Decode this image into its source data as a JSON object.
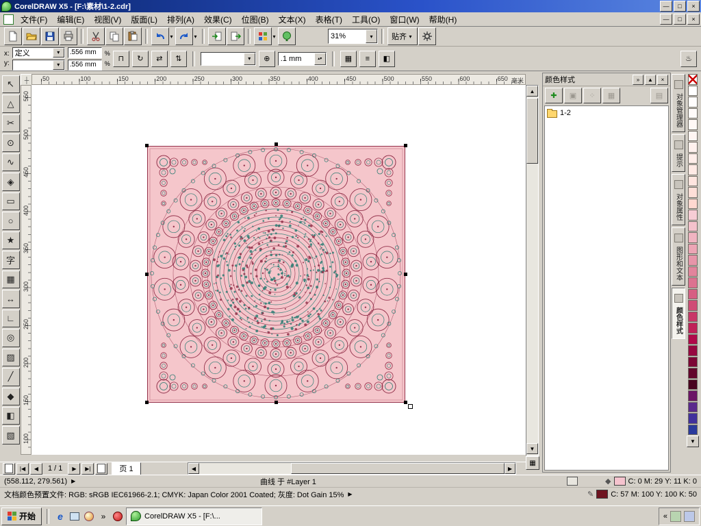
{
  "window": {
    "title": "CorelDRAW X5 - [F:\\素材\\1-2.cdr]"
  },
  "icons": {
    "minimize": "—",
    "maximize": "□",
    "close": "×",
    "dropdown": "▾",
    "scroll_up": "▲",
    "scroll_down": "▼",
    "scroll_left": "◀",
    "scroll_right": "▶",
    "nav_first": "|◀",
    "nav_prev": "◀",
    "nav_next": "▶",
    "nav_last": "▶|",
    "docker_chevron": "»",
    "docker_rollup": "▲",
    "docker_close": "×",
    "ql_chevron": "»",
    "tray_chevron": "«",
    "navigator": "▦",
    "ruler_origin": "┼",
    "ie": "e",
    "coord_flyout": "▶",
    "profile_flyout": "▶",
    "fill_status": "◆",
    "outline_status": "✎"
  },
  "menubar": {
    "items": [
      "文件(F)",
      "编辑(E)",
      "视图(V)",
      "版面(L)",
      "排列(A)",
      "效果(C)",
      "位图(B)",
      "文本(X)",
      "表格(T)",
      "工具(O)",
      "窗口(W)",
      "帮助(H)"
    ]
  },
  "toolbar": {
    "zoom_value": "31%",
    "snap_label": "贴齐",
    "items": [
      {
        "icon": "new",
        "name": "new-button"
      },
      {
        "icon": "open",
        "name": "open-button"
      },
      {
        "icon": "save",
        "name": "save-button"
      },
      {
        "icon": "print",
        "name": "print-button"
      },
      {
        "sep": true
      },
      {
        "icon": "cut",
        "name": "cut-button"
      },
      {
        "icon": "copy",
        "name": "copy-button"
      },
      {
        "icon": "paste",
        "name": "paste-button"
      },
      {
        "sep": true
      },
      {
        "icon": "undo",
        "name": "undo-button",
        "dropdown": true
      },
      {
        "icon": "redo",
        "name": "redo-button",
        "dropdown": true
      },
      {
        "sep": true
      },
      {
        "icon": "import",
        "name": "import-button"
      },
      {
        "icon": "export",
        "name": "export-button"
      },
      {
        "sep": true
      },
      {
        "icon": "app-launcher",
        "name": "application-launcher-button",
        "dropdown": true
      },
      {
        "icon": "welcome",
        "name": "welcome-screen-button"
      },
      {
        "zoom": true
      },
      {
        "sep": true
      },
      {
        "snap": true
      },
      {
        "icon": "options",
        "name": "options-button"
      }
    ]
  },
  "propbar": {
    "x_label": "x:",
    "y_label": "y:",
    "preset_value": "定义",
    "width_value": ".556 mm",
    "height_value": ".556 mm",
    "percent_label": "%",
    "nudge_value": ".1 mm"
  },
  "rulers": {
    "unit_label": "毫米",
    "h_ticks": [
      "50",
      "100",
      "150",
      "200",
      "250",
      "300",
      "350",
      "400",
      "450",
      "500",
      "550",
      "600",
      "650"
    ],
    "v_ticks": [
      "550",
      "500",
      "450",
      "400",
      "350",
      "300",
      "250",
      "200",
      "150",
      "100"
    ]
  },
  "toolbox": {
    "tools": [
      {
        "name": "pick-tool",
        "glyph": "↖"
      },
      {
        "name": "shape-tool",
        "glyph": "△"
      },
      {
        "name": "crop-tool",
        "glyph": "✂"
      },
      {
        "name": "zoom-tool",
        "glyph": "⊙"
      },
      {
        "name": "freehand-tool",
        "glyph": "∿"
      },
      {
        "name": "smart-fill-tool",
        "glyph": "◈"
      },
      {
        "name": "rectangle-tool",
        "glyph": "▭"
      },
      {
        "name": "ellipse-tool",
        "glyph": "○"
      },
      {
        "name": "polygon-tool",
        "glyph": "★"
      },
      {
        "name": "text-tool",
        "glyph": "字"
      },
      {
        "name": "table-tool",
        "glyph": "▦"
      },
      {
        "name": "dimension-tool",
        "glyph": "↔"
      },
      {
        "name": "connector-tool",
        "glyph": "∟"
      },
      {
        "name": "blend-tool",
        "glyph": "◎"
      },
      {
        "name": "transparency-tool",
        "glyph": "▨"
      },
      {
        "name": "eyedropper-tool",
        "glyph": "╱"
      },
      {
        "name": "outline-pen-tool",
        "glyph": "◆"
      },
      {
        "name": "fill-tool",
        "glyph": "◧"
      },
      {
        "name": "interactive-fill-tool",
        "glyph": "▧"
      }
    ]
  },
  "canvas": {
    "artwork": {
      "bg": "#f5c6cb",
      "primary": "#93304a",
      "secondary": "#2e7d74"
    }
  },
  "docker": {
    "title": "颜色样式",
    "item_label": "1-2"
  },
  "docker_tabs": {
    "tabs": [
      {
        "label": "对象管理器",
        "active": false
      },
      {
        "label": "提示",
        "active": false
      },
      {
        "label": "对象属性",
        "active": false
      },
      {
        "label": "图形和文本",
        "active": false
      },
      {
        "label": "颜色样式",
        "active": true
      }
    ]
  },
  "palette": {
    "colors": [
      "none",
      "#ffffff",
      "#fffdfc",
      "#fffbf9",
      "#fff8f6",
      "#fff5f2",
      "#fff1ee",
      "#ffeeea",
      "#ffeae5",
      "#ffe5df",
      "#ffdfd8",
      "#ffd8d0",
      "#f7cdd5",
      "#f4c2cc",
      "#f0b4c1",
      "#eca5b5",
      "#e795a9",
      "#e2849c",
      "#dc7290",
      "#d65f83",
      "#cf4b75",
      "#c83667",
      "#c02058",
      "#b00a4a",
      "#960840",
      "#7c0635",
      "#62052b",
      "#490420",
      "#6b1566",
      "#5a2a8c",
      "#41319c",
      "#2a3a9c"
    ]
  },
  "pagebar": {
    "page_indicator": "1 / 1",
    "page_tab_label": "页 1"
  },
  "statusbar": {
    "coords": "(558.112, 279.561)",
    "object_info": "曲线 于 #Layer 1",
    "fill_values": "C: 0 M: 29 Y: 11 K: 0",
    "fill_color": "#f5c3ce",
    "outline_values": "C: 57 M: 100 Y: 100 K: 50",
    "outline_color": "#6e1420",
    "profile_text": "文档颜色预置文件: RGB: sRGB IEC61966-2.1; CMYK: Japan Color 2001 Coated; 灰度: Dot Gain 15%"
  },
  "taskbar": {
    "start_label": "开始",
    "task_label": "CorelDRAW X5 - [F:\\..."
  }
}
